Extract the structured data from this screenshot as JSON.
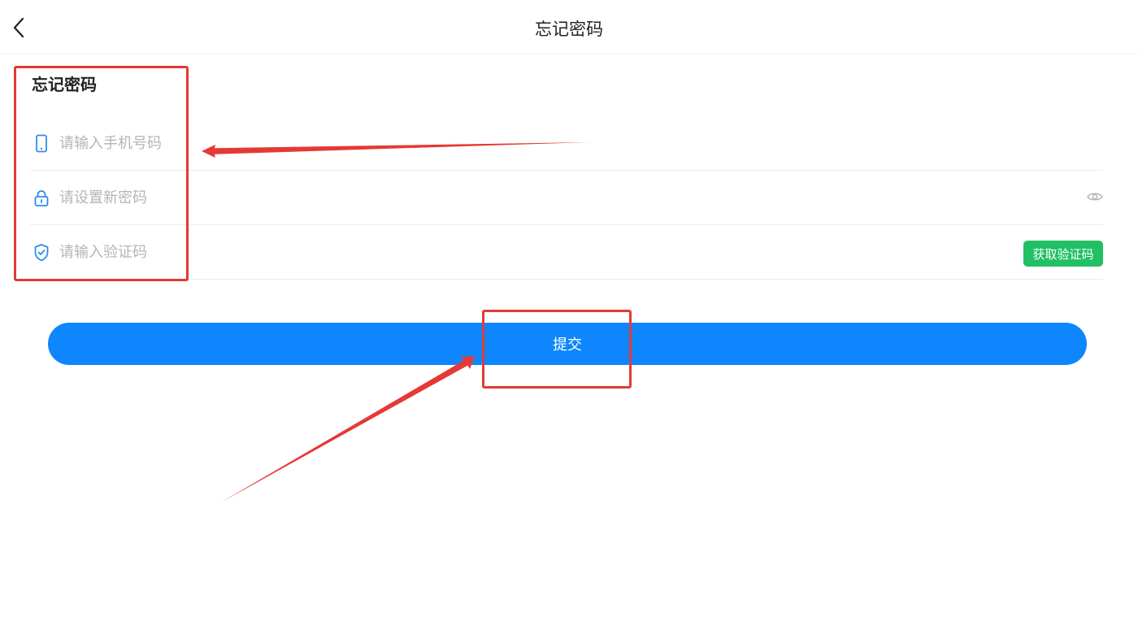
{
  "header": {
    "title": "忘记密码"
  },
  "form": {
    "title": "忘记密码",
    "phone": {
      "value": "",
      "placeholder": "请输入手机号码"
    },
    "password": {
      "value": "",
      "placeholder": "请设置新密码"
    },
    "code": {
      "value": "",
      "placeholder": "请输入验证码",
      "get_code_label": "获取验证码"
    },
    "submit_label": "提交"
  },
  "icons": {
    "back": "chevron-left-icon",
    "phone": "phone-icon",
    "lock": "lock-icon",
    "shield": "shield-check-icon",
    "eye": "eye-icon"
  },
  "colors": {
    "primary": "#0e86fe",
    "success": "#21c064",
    "icon": "#2f8cf0",
    "placeholder": "#b5b5b5",
    "annotation": "#e53935"
  }
}
